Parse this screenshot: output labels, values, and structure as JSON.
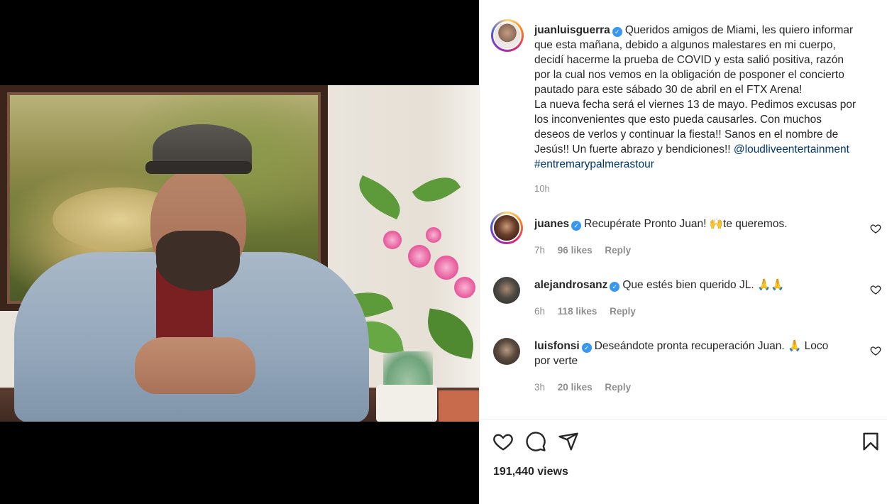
{
  "post": {
    "author": "juanluisguerra",
    "caption_lines": [
      "Queridos amigos de Miami, les quiero informar",
      "que esta mañana, debido a algunos malestares en mi cuerpo,",
      "decidí hacerme la prueba de COVID y esta salió positiva, razón",
      "por la cual nos vemos en la obligación de posponer el concierto",
      "pautado para este sábado 30 de abril en el FTX Arena!",
      "La nueva fecha será el viernes 13 de mayo. Pedimos excusas por",
      "los inconvenientes que esto pueda causarles. Con muchos",
      "deseos de verlos y continuar la fiesta!! Sanos en el nombre de",
      "Jesús!! Un fuerte abrazo y bendiciones!!"
    ],
    "mention": "@loudliveentertainment",
    "hashtag": "#entremarypalmerastour",
    "time": "10h",
    "views": "191,440 views"
  },
  "comments": [
    {
      "user": "juanes",
      "text": "Recupérate Pronto Juan! 🙌te queremos.",
      "time": "7h",
      "likes": "96 likes",
      "reply": "Reply"
    },
    {
      "user": "alejandrosanz",
      "text": "Que estés bien querido JL. 🙏🙏",
      "time": "6h",
      "likes": "118 likes",
      "reply": "Reply"
    },
    {
      "user": "luisfonsi",
      "text_line1": "Deseándote pronta recuperación Juan. 🙏 Loco",
      "text_line2": "por verte",
      "time": "3h",
      "likes": "20 likes",
      "reply": "Reply"
    }
  ],
  "icons": {
    "verified": "verified-badge-icon",
    "like": "heart-icon",
    "comment": "comment-bubble-icon",
    "share": "paper-plane-icon",
    "save": "bookmark-icon"
  },
  "colors": {
    "verified": "#3897f0",
    "link": "#00376b",
    "muted": "#8e8e8e",
    "text": "#262626"
  }
}
